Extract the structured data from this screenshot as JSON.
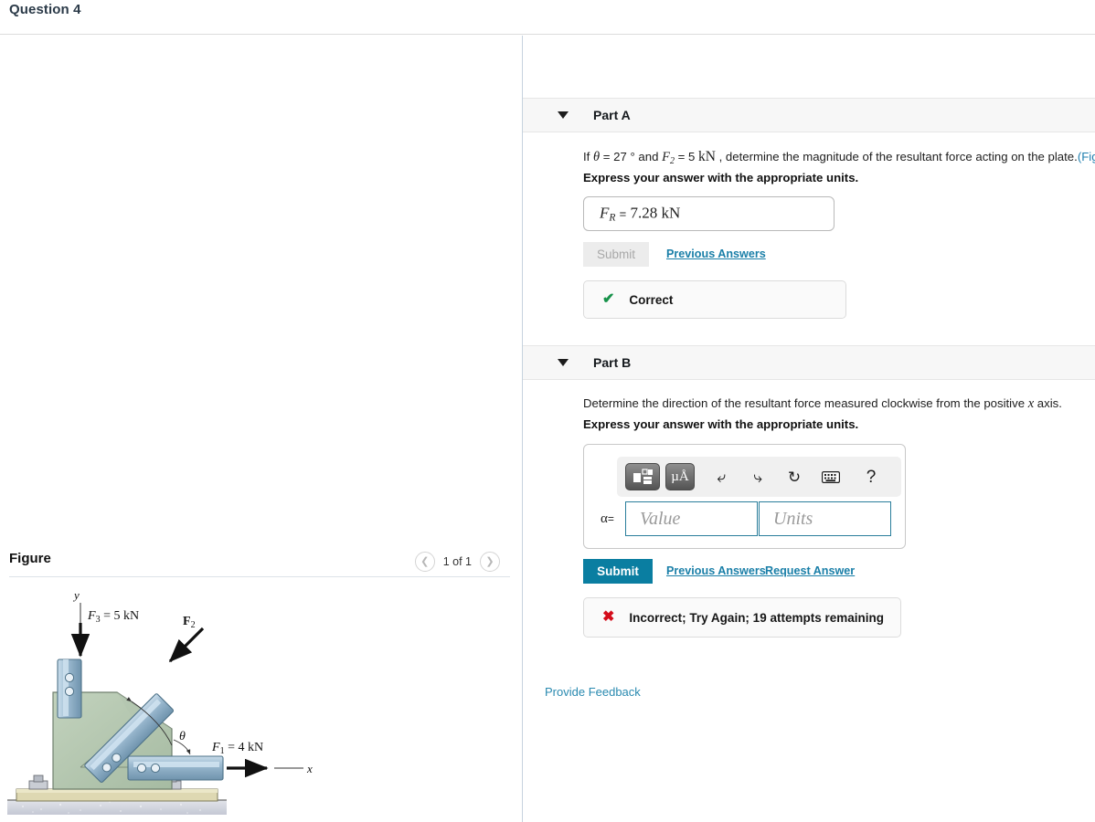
{
  "header": {
    "title": "Question 4"
  },
  "figure_panel": {
    "title": "Figure",
    "page_indicator": "1 of 1",
    "prev_icon": "chevron-left-icon",
    "next_icon": "chevron-right-icon",
    "diagram": {
      "axis_y_label": "y",
      "axis_x_label": "x",
      "force_f3": "F3 = 5 kN",
      "force_f3_symbol": "F",
      "force_f3_sub": "3",
      "force_f3_value": "= 5 kN",
      "force_f2": "F2",
      "force_f2_symbol": "F",
      "force_f2_sub": "2",
      "force_f1_symbol": "F",
      "force_f1_sub": "1",
      "force_f1_value": "= 4 kN",
      "angle_label": "θ",
      "colors": {
        "plate": "#b4c6b0",
        "plate_dark": "#9fb59c",
        "bar": "#8fb0c6",
        "bar_light": "#c3d8e6",
        "bar_dark": "#5d87a5",
        "base": "#d9d3aa",
        "ground": "#cfd2dc"
      }
    }
  },
  "parts": [
    {
      "id": "part-a",
      "label": "Part A",
      "caret_icon": "caret-down-icon",
      "prompt_prefix": "If ",
      "prompt_theta": "θ",
      "prompt_eq1": " = 27 °  and ",
      "prompt_f2": "F",
      "prompt_f2_sub": "2",
      "prompt_eq2": " = 5 ",
      "prompt_kn": "kN",
      "prompt_rest": " , determine the magnitude of the resultant force acting on the plate.",
      "prompt_link": "(Fig",
      "instruction": "Express your answer with the appropriate units.",
      "answer": {
        "symbol": "F",
        "symbol_sub": "R",
        "equals": "=",
        "value": "7.28 kN"
      },
      "submit_label": "Submit",
      "submit_enabled": false,
      "previous_answers_label": "Previous Answers",
      "status": {
        "icon": "check-icon",
        "text": "Correct",
        "state": "correct"
      }
    },
    {
      "id": "part-b",
      "label": "Part B",
      "caret_icon": "caret-down-icon",
      "prompt_a": "Determine the direction of the resultant force measured clockwise from the positive ",
      "prompt_x": "x",
      "prompt_b": " axis.",
      "instruction": "Express your answer with the appropriate units.",
      "toolbar": {
        "template_button": "template-icon",
        "units_button_label": "µÅ",
        "undo_icon": "undo-arrow-icon",
        "redo_icon": "redo-arrow-icon",
        "reset_icon": "reset-circular-arrow-icon",
        "keyboard_icon": "keyboard-icon",
        "help_icon": "question-mark-icon"
      },
      "variable_label": "α",
      "variable_equals": "=",
      "value_placeholder": "Value",
      "units_placeholder": "Units",
      "value_text": "",
      "units_text": "",
      "submit_label": "Submit",
      "submit_enabled": true,
      "previous_answers_label": "Previous Answers",
      "request_answer_label": "Request Answer",
      "status": {
        "icon": "cross-icon",
        "text": "Incorrect; Try Again; 19 attempts remaining",
        "state": "incorrect"
      }
    }
  ],
  "footer": {
    "provide_feedback_label": "Provide Feedback"
  },
  "theme": {
    "accent": "#0a7ea1",
    "link": "#1a7fa8",
    "correct": "#17924a",
    "incorrect": "#d40d1b",
    "panel_bg": "#f7f7f7"
  }
}
